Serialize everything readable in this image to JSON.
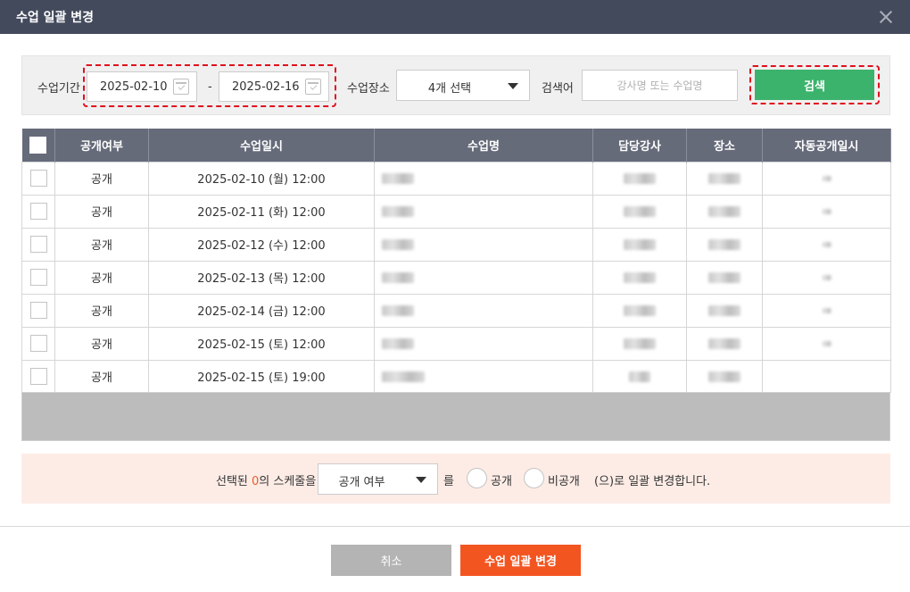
{
  "modal": {
    "title": "수업 일괄 변경"
  },
  "search": {
    "period_label": "수업기간",
    "date_from": "2025-02-10",
    "date_separator": "-",
    "date_to": "2025-02-16",
    "place_label": "수업장소",
    "place_value": "4개 선택",
    "keyword_label": "검색어",
    "keyword_placeholder": "강사명 또는 수업명",
    "search_button": "검색"
  },
  "table": {
    "headers": [
      "공개여부",
      "수업일시",
      "수업명",
      "담당강사",
      "장소",
      "자동공개일시"
    ],
    "rows": [
      {
        "status": "공개",
        "datetime": "2025-02-10 (월) 12:00"
      },
      {
        "status": "공개",
        "datetime": "2025-02-11 (화) 12:00"
      },
      {
        "status": "공개",
        "datetime": "2025-02-12 (수) 12:00"
      },
      {
        "status": "공개",
        "datetime": "2025-02-13 (목) 12:00"
      },
      {
        "status": "공개",
        "datetime": "2025-02-14 (금) 12:00"
      },
      {
        "status": "공개",
        "datetime": "2025-02-15 (토) 12:00"
      },
      {
        "status": "공개",
        "datetime": "2025-02-15 (토) 19:00"
      }
    ]
  },
  "bulk": {
    "prefix": "선택된 ",
    "count": "0",
    "suffix": "의 스케줄을",
    "select_value": "공개 여부",
    "particle": "를",
    "option_public": "공개",
    "option_private": "비공개",
    "tail": "(으)로 일괄 변경합니다."
  },
  "footer": {
    "cancel_label": "취소",
    "submit_label": "수업 일괄 변경"
  },
  "colors": {
    "titlebar": "#434a5c",
    "search_button": "#3bb36c",
    "submit_button": "#f35521",
    "cancel_button": "#b4b4b4",
    "public_text": "#3b9c5a",
    "count_text": "#f05a28",
    "bulk_bar": "#fdece6"
  }
}
